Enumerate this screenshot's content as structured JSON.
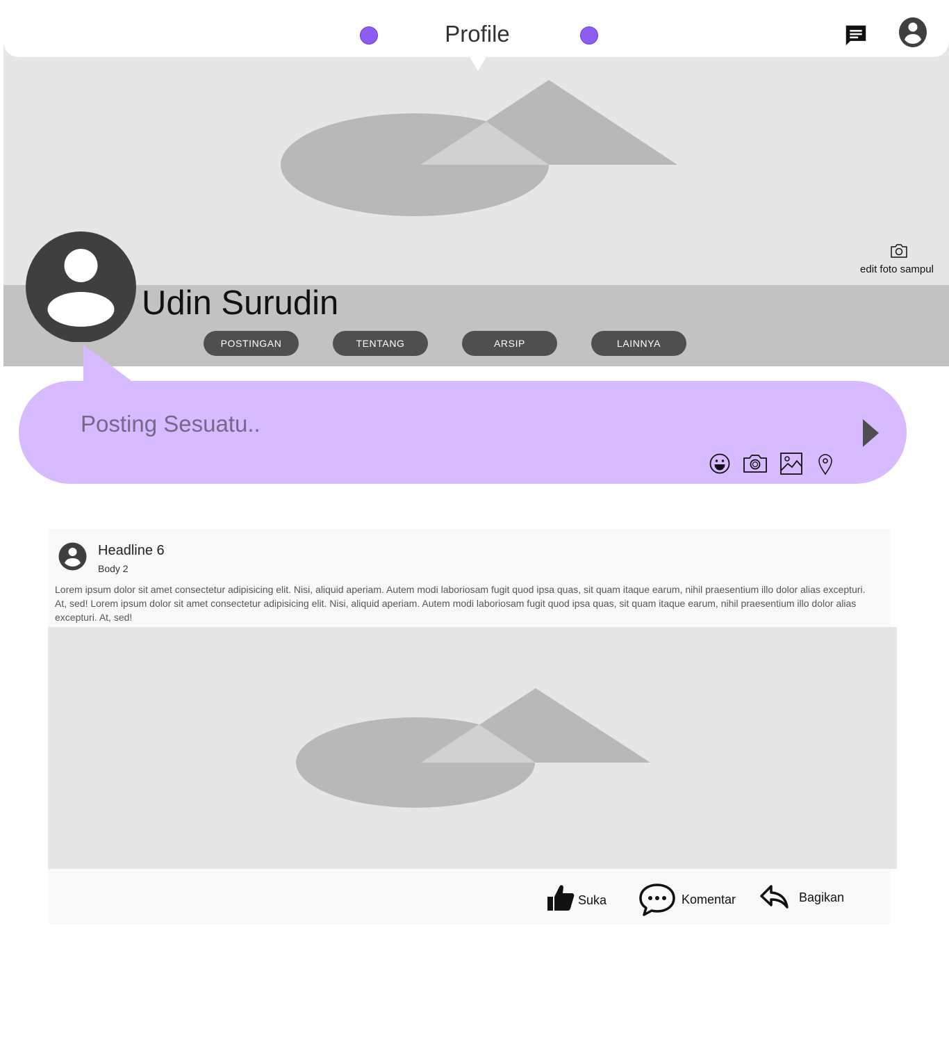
{
  "header": {
    "title": "Profile",
    "icons": [
      "chat-icon",
      "account-icon"
    ]
  },
  "cover": {
    "edit_label": "edit foto sampul",
    "edit_icon": "camera-icon"
  },
  "profile": {
    "name": "Udin Surudin",
    "tabs": [
      {
        "label": "POSTINGAN"
      },
      {
        "label": "TENTANG"
      },
      {
        "label": "ARSIP"
      },
      {
        "label": "LAINNYA"
      }
    ]
  },
  "composer": {
    "placeholder": "Posting Sesuatu..",
    "icons": [
      "emoji-icon",
      "camera-icon",
      "image-icon",
      "location-icon"
    ],
    "send_icon": "send-icon"
  },
  "post": {
    "headline": "Headline 6",
    "subtitle": "Body 2",
    "body": "Lorem ipsum dolor sit amet consectetur adipisicing elit. Nisi, aliquid aperiam. Autem modi laboriosam fugit quod ipsa quas, sit quam itaque earum, nihil praesentium illo dolor alias excepturi. At, sed! Lorem ipsum dolor sit amet consectetur adipisicing elit. Nisi, aliquid aperiam. Autem modi laboriosam fugit quod ipsa quas, sit quam itaque earum, nihil praesentium illo dolor alias excepturi. At, sed!",
    "actions": {
      "like": "Suka",
      "comment": "Komentar",
      "share": "Bagikan"
    }
  },
  "colors": {
    "accent_dot": "#8f5cf0",
    "composer_bg": "#d7baff",
    "tab_bg": "#4f4f4f",
    "cover_bg": "#e6e6e6",
    "name_bar_bg": "#c2c2c2"
  }
}
